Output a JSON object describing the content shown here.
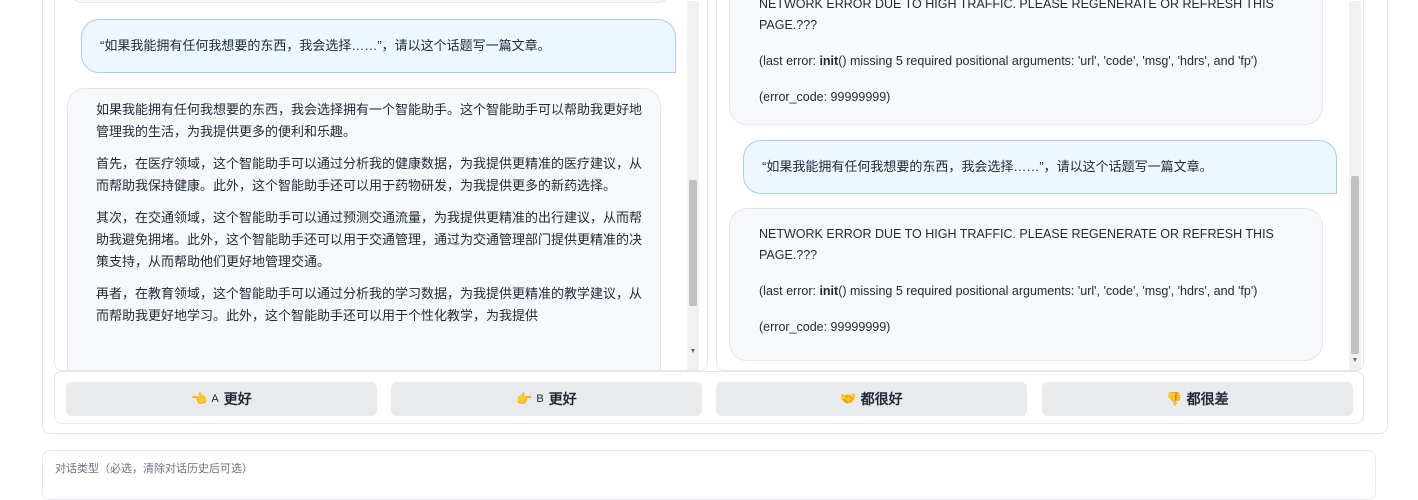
{
  "left_chat": {
    "top_bubble_stub": "",
    "user_prompt": "“如果我能拥有任何我想要的东西，我会选择……”，请以这个话题写一篇文章。",
    "bot_paragraphs": [
      "如果我能拥有任何我想要的东西，我会选择拥有一个智能助手。这个智能助手可以帮助我更好地管理我的生活，为我提供更多的便利和乐趣。",
      "首先，在医疗领域，这个智能助手可以通过分析我的健康数据，为我提供更精准的医疗建议，从而帮助我保持健康。此外，这个智能助手还可以用于药物研发，为我提供更多的新药选择。",
      "其次，在交通领域，这个智能助手可以通过预测交通流量，为我提供更精准的出行建议，从而帮助我避免拥堵。此外，这个智能助手还可以用于交通管理，通过为交通管理部门提供更精准的决策支持，从而帮助他们更好地管理交通。",
      "再者，在教育领域，这个智能助手可以通过分析我的学习数据，为我提供更精准的教学建议，从而帮助我更好地学习。此外，这个智能助手还可以用于个性化教学，为我提供"
    ]
  },
  "right_chat": {
    "error_1": {
      "headline": "NETWORK ERROR DUE TO HIGH TRAFFIC. PLEASE REGENERATE OR REFRESH THIS PAGE.???",
      "detail_prefix": "(last error: ",
      "detail_func": "init",
      "detail_rest": "() missing 5 required positional arguments: 'url', 'code', 'msg', 'hdrs', and 'fp')",
      "code": "(error_code: 99999999)"
    },
    "user_prompt": "“如果我能拥有任何我想要的东西，我会选择……”，请以这个话题写一篇文章。",
    "error_2": {
      "headline": "NETWORK ERROR DUE TO HIGH TRAFFIC. PLEASE REGENERATE OR REFRESH THIS PAGE.???",
      "detail_prefix": "(last error: ",
      "detail_func": "init",
      "detail_rest": "() missing 5 required positional arguments: 'url', 'code', 'msg', 'hdrs', and 'fp')",
      "code": "(error_code: 99999999)"
    }
  },
  "votes": {
    "a_better": {
      "icon": "👈",
      "prefix": "A",
      "label": "更好"
    },
    "b_better": {
      "icon": "👉",
      "prefix": "B",
      "label": "更好"
    },
    "both_good": {
      "icon": "🤝",
      "label": "都很好"
    },
    "both_bad": {
      "icon": "👎",
      "label": "都很差"
    }
  },
  "dialog_type_label": "对话类型（必选，清除对话历史后可选）",
  "colors": {
    "user_bubble": "#eef6ff",
    "user_border": "#a9cdf6",
    "bot_bubble": "#f6f8fb",
    "button": "#e9eaec",
    "heart": "#f5a623"
  }
}
